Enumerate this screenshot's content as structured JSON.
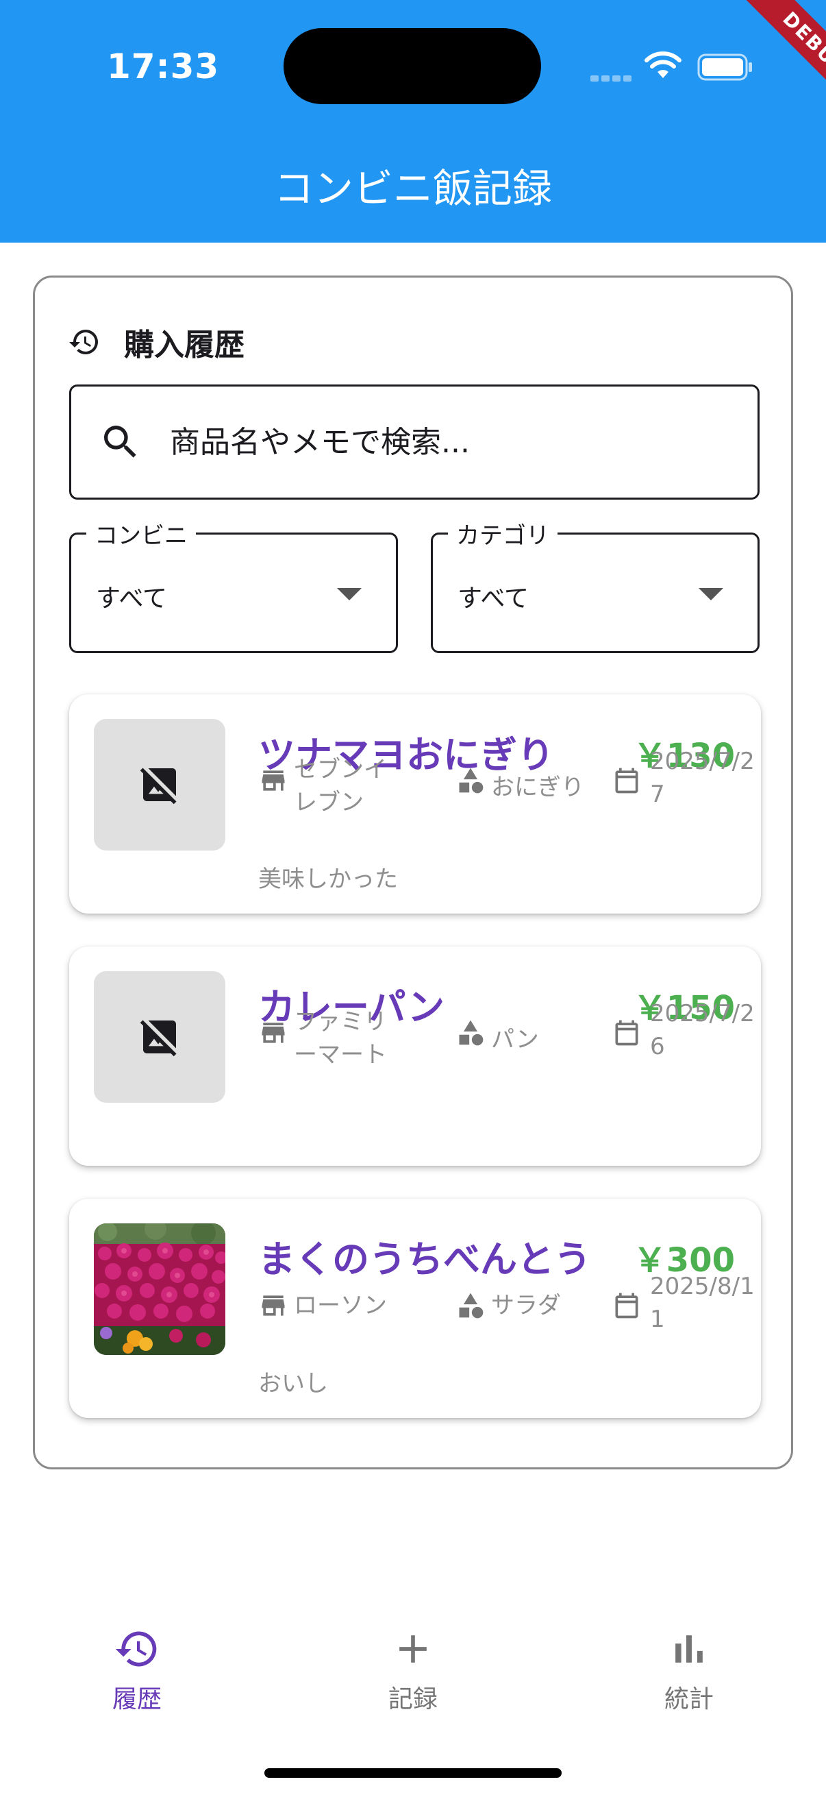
{
  "status_bar": {
    "time": "17:33",
    "debug_banner": "DEBUG"
  },
  "app_bar": {
    "title": "コンビニ飯記録"
  },
  "history": {
    "title": "購入履歴",
    "search": {
      "placeholder": "商品名やメモで検索...",
      "value": ""
    },
    "filters": {
      "store": {
        "label": "コンビニ",
        "value": "すべて"
      },
      "category": {
        "label": "カテゴリ",
        "value": "すべて"
      }
    },
    "items": [
      {
        "name": "ツナマヨおにぎり",
        "price": "￥130",
        "store_line1": "セブンイ",
        "store_line2": "レブン",
        "category": "おにぎり",
        "date_line1": "2025/7/2",
        "date_line2": "7",
        "memo": "美味しかった",
        "image": "no-image-icon"
      },
      {
        "name": "カレーパン",
        "price": "￥150",
        "store_line1": "ファミリ",
        "store_line2": "ーマート",
        "category": "パン",
        "date_line1": "2025/7/2",
        "date_line2": "6",
        "memo": "",
        "image": "no-image-icon"
      },
      {
        "name": "まくのうちべんとう",
        "price": "￥300",
        "store_line1": "ローソン",
        "store_line2": "",
        "category": "サラダ",
        "date_line1": "2025/8/1",
        "date_line2": "1",
        "memo": "おいし",
        "image": "flower-photo"
      }
    ]
  },
  "bottom_nav": {
    "items": [
      {
        "label": "履歴",
        "icon": "history-icon",
        "active": true
      },
      {
        "label": "記録",
        "icon": "add-icon",
        "active": false
      },
      {
        "label": "統計",
        "icon": "bar-chart-icon",
        "active": false
      }
    ]
  },
  "colors": {
    "app_bar": "#2196f3",
    "item_name": "#673ab7",
    "price": "#4caf50",
    "nav_active": "#673ab7",
    "nav_inactive": "#757575",
    "meta_text": "#8e8e8e"
  }
}
